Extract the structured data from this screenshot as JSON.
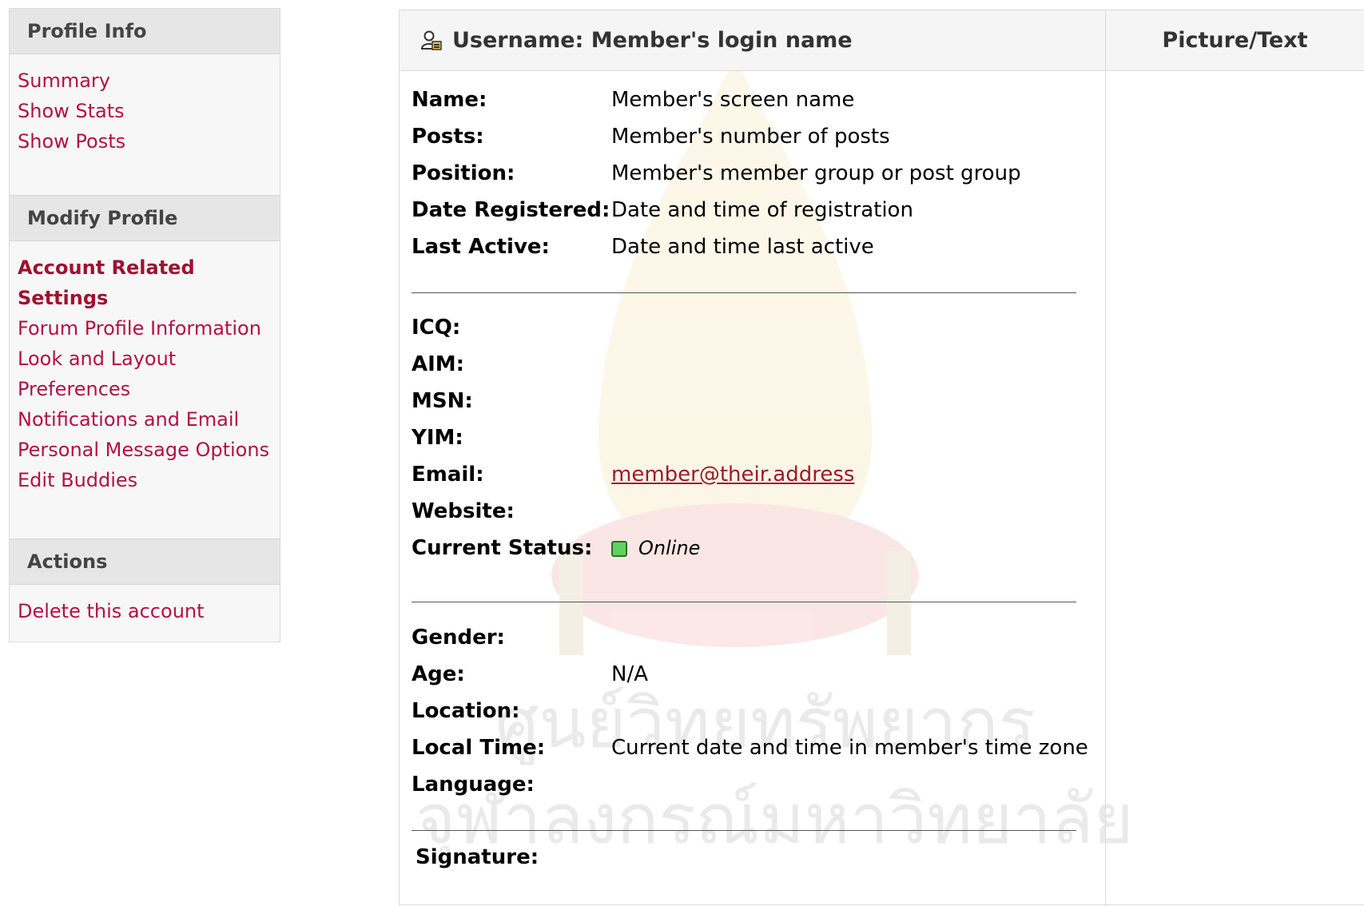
{
  "sidebar": {
    "profile_info": {
      "title": "Profile Info",
      "items": [
        "Summary",
        "Show Stats",
        "Show Posts"
      ]
    },
    "modify_profile": {
      "title": "Modify Profile",
      "items": [
        "Account Related Settings",
        "Forum Profile Information",
        "Look and Layout Preferences",
        "Notifications and Email",
        "Personal Message Options",
        "Edit Buddies"
      ]
    },
    "actions": {
      "title": "Actions",
      "items": [
        "Delete this account"
      ]
    }
  },
  "header": {
    "username": "Username: Member's login name",
    "picture_text": "Picture/Text"
  },
  "profile": {
    "name_label": "Name:",
    "name_value": "Member's screen name",
    "posts_label": "Posts:",
    "posts_value": "Member's number of posts",
    "position_label": "Position:",
    "position_value": "Member's member group or post group",
    "registered_label": "Date Registered:",
    "registered_value": "Date and time of registration",
    "active_label": "Last Active:",
    "active_value": "Date and time last active",
    "icq_label": "ICQ:",
    "aim_label": "AIM:",
    "msn_label": "MSN:",
    "yim_label": "YIM:",
    "email_label": "Email:",
    "email_value": "member@their.address",
    "website_label": "Website:",
    "status_label": "Current Status:",
    "status_value": "Online",
    "gender_label": "Gender:",
    "age_label": "Age:",
    "age_value": "N/A",
    "location_label": "Location:",
    "localtime_label": "Local Time:",
    "localtime_value": "Current date and time in member's time zone",
    "language_label": "Language:",
    "signature_label": "Signature:"
  },
  "watermark": {
    "line1": "ศูนย์วิทยทรัพยากร",
    "line2": "จุฬาลงกรณ์มหาวิทยาลัย"
  },
  "colors": {
    "link": "#b31142",
    "status_online": "#5fd35f"
  }
}
